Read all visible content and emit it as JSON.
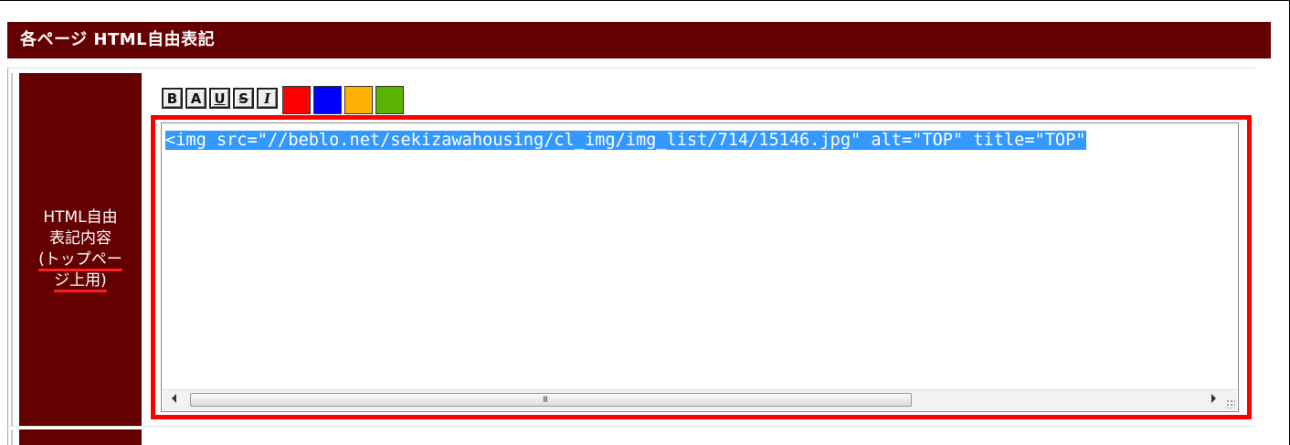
{
  "header": {
    "title": "各ページ HTML自由表記"
  },
  "field": {
    "label_line1": "HTML自由",
    "label_line2": "表記内容",
    "label_note_line1": "(トップペー",
    "label_note_line2": "ジ上用)"
  },
  "toolbar": {
    "buttons": [
      {
        "label": "B",
        "name": "bold"
      },
      {
        "label": "A",
        "name": "font"
      },
      {
        "label": "U",
        "name": "underline"
      },
      {
        "label": "S",
        "name": "strikethrough"
      },
      {
        "label": "I",
        "name": "italic"
      }
    ],
    "colors": [
      "#ff0000",
      "#0000ff",
      "#ffb000",
      "#59b300"
    ]
  },
  "editor": {
    "content": "<img src=\"//beblo.net/sekizawahousing/cl_img/img_list/714/15146.jpg\" alt=\"TOP\" title=\"TOP\"",
    "scrollbar_grip": "III"
  },
  "colors": {
    "header_bg": "#650000",
    "highlight_border": "#ff0000",
    "selection": "#3399ff"
  }
}
